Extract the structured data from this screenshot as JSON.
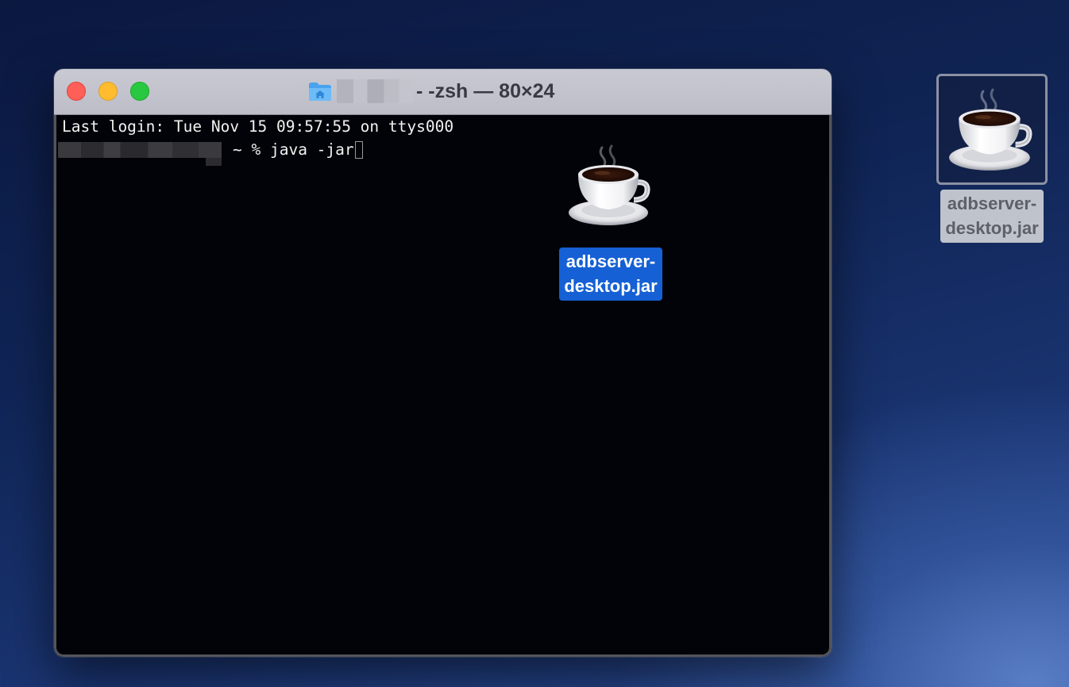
{
  "window": {
    "title": "- -zsh — 80×24",
    "folder_icon": "home-folder-icon"
  },
  "terminal": {
    "last_login": "Last login: Tue Nov 15 09:57:55 on ttys000",
    "prompt_suffix": "~ %",
    "command": " java -jar"
  },
  "drag_file": {
    "label_line1": "adbserver-",
    "label_line2": "desktop.jar",
    "icon": "java-coffee-cup-icon"
  },
  "desktop_file": {
    "label_line1": "adbserver-",
    "label_line2": "desktop.jar",
    "icon": "java-coffee-cup-icon"
  },
  "colors": {
    "close": "#fe5f57",
    "minimize": "#febc2e",
    "zoom": "#28c840",
    "selection": "#1560d4"
  }
}
